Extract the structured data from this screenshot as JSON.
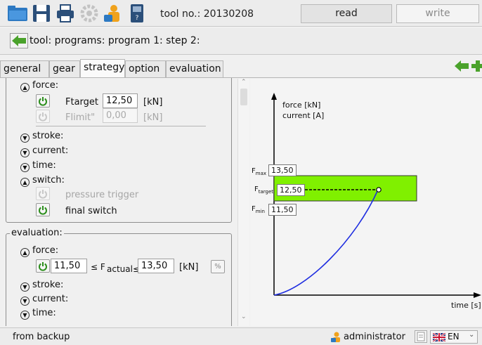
{
  "toolbar": {
    "tool_no": "tool no.: 20130208",
    "read_label": "read",
    "write_label": "write"
  },
  "breadcrumb": {
    "text": "tool: programs: program 1: step 2:"
  },
  "tabs": [
    "general",
    "gear",
    "strategy",
    "option",
    "evaluation"
  ],
  "strategy": {
    "force": {
      "label": "force:",
      "ftarget_label": "Ftarget",
      "ftarget_value": "12,50",
      "ftarget_unit": "[kN]",
      "flimit_label": "Flimit\"",
      "flimit_value": "0,00",
      "flimit_unit": "[kN]"
    },
    "stroke": "stroke:",
    "current": "current:",
    "time": "time:",
    "switch": {
      "label": "switch:",
      "pressure_trigger": "pressure trigger",
      "final_switch": "final switch"
    }
  },
  "evaluation": {
    "title": "evaluation:",
    "force": "force:",
    "min_value": "11,50",
    "le_f": "≤ F",
    "actual_le": "actual≤",
    "max_value": "13,50",
    "unit": "[kN]",
    "stroke": "stroke:",
    "current": "current:",
    "time": "time:"
  },
  "chart": {
    "ylabel_line1": "force [kN]",
    "ylabel_line2": "current [A]",
    "xlabel": "time [s]",
    "fmax_label": "F",
    "fmax_sub": "max",
    "fmax_value": "13,50",
    "ftarget_label": "F",
    "ftarget_sub": "target",
    "ftarget_value": "12,50",
    "fmin_label": "F",
    "fmin_sub": "min",
    "fmin_value": "11,50"
  },
  "status": {
    "left": "from backup",
    "user": "administrator",
    "lang": "EN"
  },
  "colors": {
    "accent_green": "#2a8d1a",
    "band_green": "#80f000",
    "curve_blue": "#1f2ee0"
  },
  "icons": [
    "folder-icon",
    "save-icon",
    "print-icon",
    "settings-icon",
    "user-icon",
    "device-icon",
    "back-arrow-icon",
    "forward-arrow-icon",
    "power-icon",
    "chevron-up-icon",
    "chevron-down-icon",
    "percent-icon",
    "language-flag-icon"
  ]
}
